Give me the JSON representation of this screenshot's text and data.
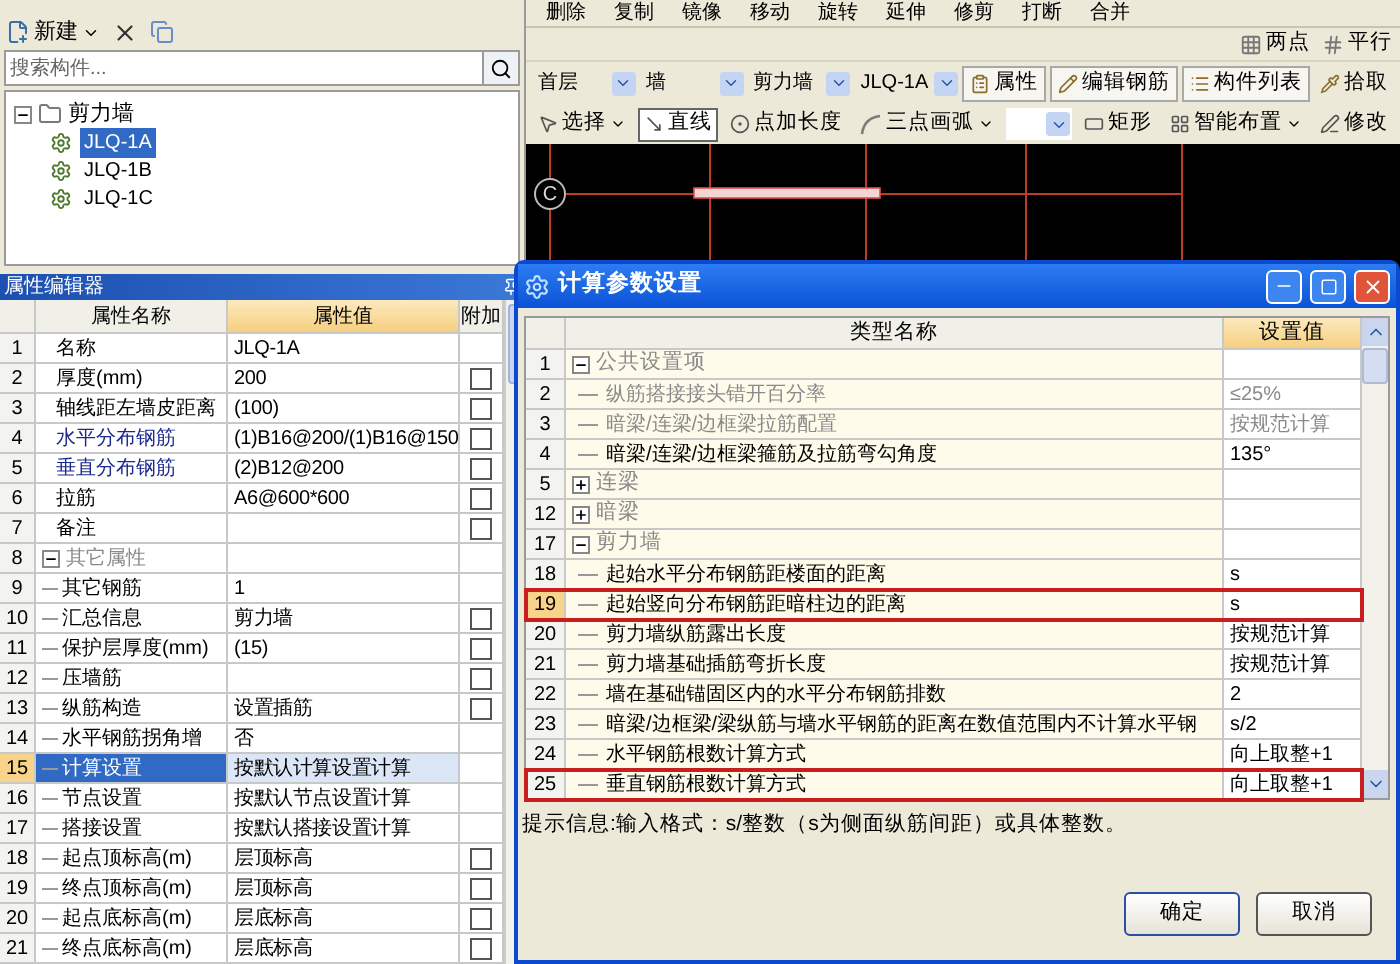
{
  "top_toolbar": [
    "删除",
    "复制",
    "镜像",
    "移动",
    "旋转",
    "延伸",
    "修剪",
    "打断",
    "合并"
  ],
  "left_toolbar": {
    "new_label": "新建"
  },
  "search": {
    "placeholder": "搜索构件..."
  },
  "tree": [
    {
      "label": "剪力墙",
      "expanded": true,
      "children": [
        {
          "label": "JLQ-1A",
          "selected": true
        },
        {
          "label": "JLQ-1B",
          "selected": false
        },
        {
          "label": "JLQ-1C",
          "selected": false
        }
      ]
    }
  ],
  "property_editor": {
    "title": "属性编辑器",
    "columns": [
      "属性名称",
      "属性值",
      "附加"
    ],
    "rows": [
      {
        "kind": "item",
        "number": "1",
        "name": "名称",
        "value": "JLQ-1A",
        "selected": false
      },
      {
        "kind": "item",
        "number": "2",
        "name": "厚度(mm)",
        "value": "200",
        "selected": false,
        "checkbox": {
          "checked": false
        }
      },
      {
        "kind": "item",
        "number": "3",
        "name": "轴线距左墙皮距离",
        "value": "(100)",
        "selected": false,
        "checkbox": {
          "checked": false
        }
      },
      {
        "kind": "item",
        "number": "4",
        "name": "水平分布钢筋",
        "value": "(1)B16@200/(1)B16@150",
        "selected": false,
        "color": "#1c2a8c",
        "checkbox": {
          "checked": false
        }
      },
      {
        "kind": "item",
        "number": "5",
        "name": "垂直分布钢筋",
        "value": "(2)B12@200",
        "selected": false,
        "color": "#1c2a8c",
        "checkbox": {
          "checked": false
        }
      },
      {
        "kind": "item",
        "number": "6",
        "name": "拉筋",
        "value": "A6@600*600",
        "selected": false,
        "checkbox": {
          "checked": false
        }
      },
      {
        "kind": "item",
        "number": "7",
        "name": "备注",
        "selected": false,
        "checkbox": {
          "checked": false
        }
      },
      {
        "kind": "group",
        "number": "8",
        "name": "其它属性",
        "expanded": true,
        "selected": false,
        "children": [
          {
            "kind": "item",
            "number": "9",
            "name": "其它钢筋",
            "value": "1",
            "selected": false
          },
          {
            "kind": "item",
            "number": "10",
            "name": "汇总信息",
            "value": "剪力墙",
            "selected": false,
            "checkbox": {
              "checked": false
            }
          },
          {
            "kind": "item",
            "number": "11",
            "name": "保护层厚度(mm)",
            "value": "(15)",
            "selected": false,
            "checkbox": {
              "checked": false
            }
          },
          {
            "kind": "item",
            "number": "12",
            "name": "压墙筋",
            "selected": false,
            "checkbox": {
              "checked": false
            }
          },
          {
            "kind": "item",
            "number": "13",
            "name": "纵筋构造",
            "value": "设置插筋",
            "selected": false,
            "checkbox": {
              "checked": false
            }
          },
          {
            "kind": "item",
            "number": "14",
            "name": "水平钢筋拐角增",
            "value": "否",
            "selected": false
          },
          {
            "kind": "item",
            "number": "15",
            "name": "计算设置",
            "value": "按默认计算设置计算",
            "selected": true
          },
          {
            "kind": "item",
            "number": "16",
            "name": "节点设置",
            "value": "按默认节点设置计算",
            "selected": false
          },
          {
            "kind": "item",
            "number": "17",
            "name": "搭接设置",
            "value": "按默认搭接设置计算",
            "selected": false
          },
          {
            "kind": "item",
            "number": "18",
            "name": "起点顶标高(m)",
            "value": "层顶标高",
            "selected": false,
            "checkbox": {
              "checked": false
            }
          },
          {
            "kind": "item",
            "number": "19",
            "name": "终点顶标高(m)",
            "value": "层顶标高",
            "selected": false,
            "checkbox": {
              "checked": false
            }
          },
          {
            "kind": "item",
            "number": "20",
            "name": "起点底标高(m)",
            "value": "层底标高",
            "selected": false,
            "checkbox": {
              "checked": false
            }
          },
          {
            "kind": "item",
            "number": "21",
            "name": "终点底标高(m)",
            "value": "层底标高",
            "selected": false,
            "checkbox": {
              "checked": false
            }
          }
        ]
      }
    ]
  },
  "snap_toolbar": [
    "两点",
    "平行"
  ],
  "selectors": [
    "首层",
    "墙",
    "剪力墙",
    "JLQ-1A"
  ],
  "component_buttons": [
    "属性",
    "编辑钢筋",
    "构件列表",
    "拾取"
  ],
  "draw_tools": [
    {
      "kind": "tool",
      "label": "选择",
      "dropdown": true,
      "selected": false
    },
    {
      "kind": "tool",
      "label": "直线",
      "dropdown": false,
      "selected": true
    },
    {
      "kind": "tool",
      "label": "点加长度",
      "dropdown": false,
      "selected": false
    },
    {
      "kind": "tool",
      "label": "三点画弧",
      "dropdown": true,
      "selected": false
    },
    {
      "kind": "combo"
    },
    {
      "kind": "tool",
      "label": "矩形",
      "dropdown": false,
      "selected": false
    },
    {
      "kind": "tool",
      "label": "智能布置",
      "dropdown": true,
      "selected": false
    },
    {
      "kind": "tool",
      "label": "修改",
      "dropdown": false,
      "selected": false
    }
  ],
  "canvas": {
    "axis_label": "C"
  },
  "dialog": {
    "title": "计算参数设置",
    "columns": [
      "类型名称",
      "设置值"
    ],
    "rows": [
      {
        "kind": "group",
        "number": "1",
        "name": "公共设置项",
        "expanded": true,
        "children": [
          {
            "kind": "item",
            "number": "2",
            "name": "纵筋搭接接头错开百分率",
            "value": "≤25%",
            "disabled": true,
            "selected": false,
            "outlined": false
          },
          {
            "kind": "item",
            "number": "3",
            "name": "暗梁/连梁/边框梁拉筋配置",
            "value": "按规范计算",
            "disabled": true,
            "selected": false,
            "outlined": false
          },
          {
            "kind": "item",
            "number": "4",
            "name": "暗梁/连梁/边框梁箍筋及拉筋弯勾角度",
            "value": "135°",
            "disabled": false,
            "selected": false,
            "outlined": false
          }
        ]
      },
      {
        "kind": "group",
        "number": "5",
        "name": "连梁",
        "expanded": false
      },
      {
        "kind": "group",
        "number": "12",
        "name": "暗梁",
        "expanded": false
      },
      {
        "kind": "group",
        "number": "17",
        "name": "剪力墙",
        "expanded": true,
        "children": [
          {
            "kind": "item",
            "number": "18",
            "name": "起始水平分布钢筋距楼面的距离",
            "value": "s",
            "disabled": false,
            "selected": false,
            "outlined": false
          },
          {
            "kind": "item",
            "number": "19",
            "name": "起始竖向分布钢筋距暗柱边的距离",
            "value": "s",
            "disabled": false,
            "selected": true,
            "outlined": true
          },
          {
            "kind": "item",
            "number": "20",
            "name": "剪力墙纵筋露出长度",
            "value": "按规范计算",
            "disabled": false,
            "selected": false,
            "outlined": false
          },
          {
            "kind": "item",
            "number": "21",
            "name": "剪力墙基础插筋弯折长度",
            "value": "按规范计算",
            "disabled": false,
            "selected": false,
            "outlined": false
          },
          {
            "kind": "item",
            "number": "22",
            "name": "墙在基础锚固区内的水平分布钢筋排数",
            "value": "2",
            "disabled": false,
            "selected": false,
            "outlined": false
          },
          {
            "kind": "item",
            "number": "23",
            "name": "暗梁/边框梁/梁纵筋与墙水平钢筋的距离在数值范围内不计算水平钢",
            "value": "s/2",
            "disabled": false,
            "selected": false,
            "outlined": false
          },
          {
            "kind": "item",
            "number": "24",
            "name": "水平钢筋根数计算方式",
            "value": "向上取整+1",
            "disabled": false,
            "selected": false,
            "outlined": false
          },
          {
            "kind": "item",
            "number": "25",
            "name": "垂直钢筋根数计算方式",
            "value": "向上取整+1",
            "disabled": false,
            "selected": false,
            "outlined": true
          }
        ]
      }
    ],
    "hint": "提示信息:输入格式：s/整数（s为侧面纵筋间距）或具体整数。",
    "buttons": [
      "确定",
      "取消"
    ]
  }
}
